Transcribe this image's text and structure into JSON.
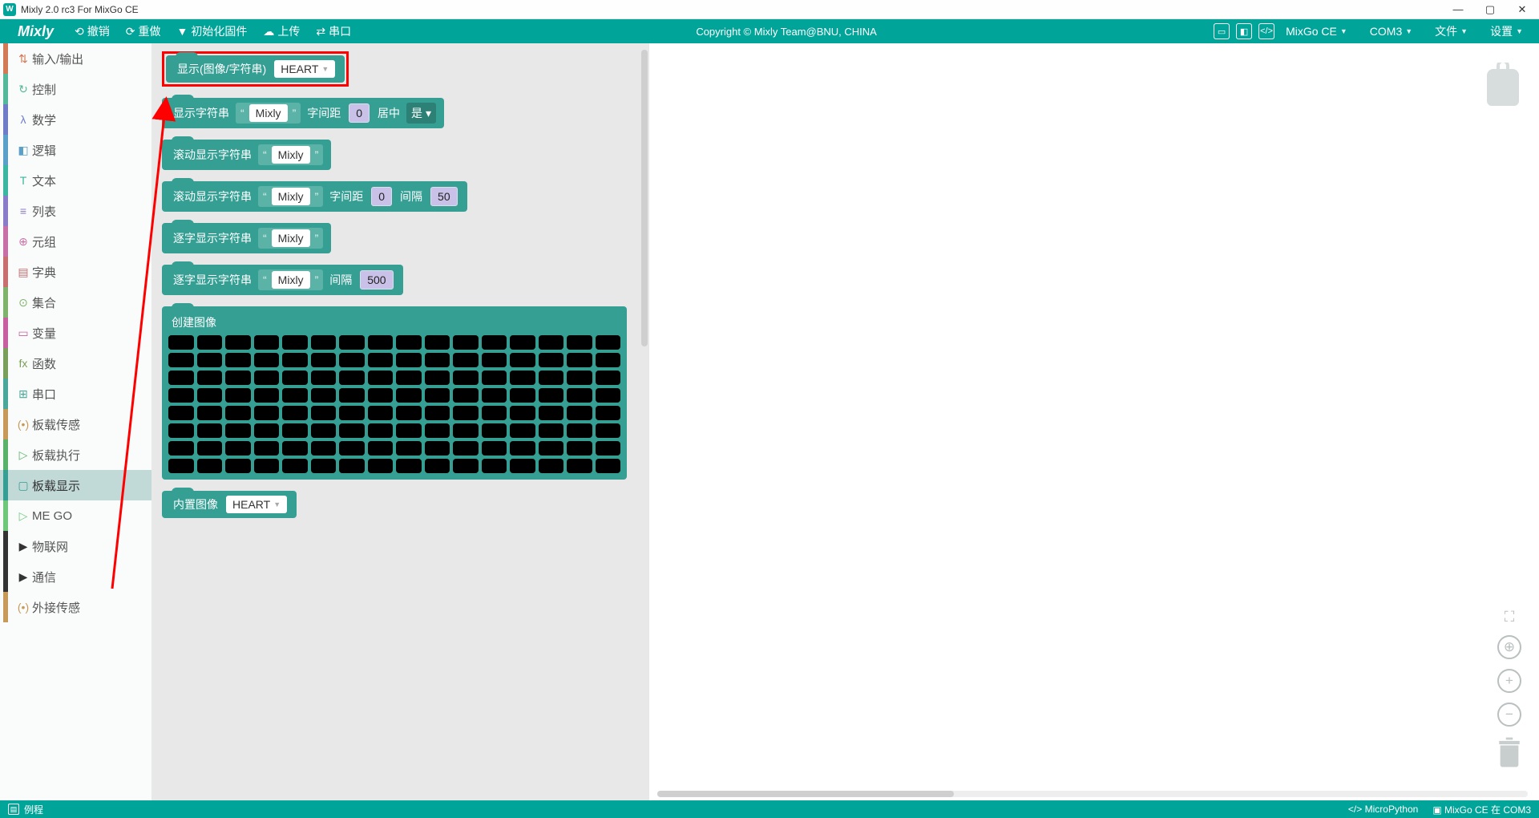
{
  "window": {
    "title": "Mixly 2.0 rc3 For MixGo CE"
  },
  "menubar": {
    "brand": "Mixly",
    "btns": [
      {
        "icon": "↺",
        "label": "撤销"
      },
      {
        "icon": "↻",
        "label": "重做"
      },
      {
        "icon": "⟲",
        "label": "初始化固件"
      },
      {
        "icon": "⬆",
        "label": "上传"
      },
      {
        "icon": "⇄",
        "label": "串口"
      }
    ],
    "copyright": "Copyright © Mixly Team@BNU, CHINA",
    "board_sel": "MixGo CE",
    "port_sel": "COM3",
    "file_menu": "文件",
    "settings_menu": "设置"
  },
  "sidebar": {
    "items": [
      {
        "label": "输入/输出",
        "color": "#d17a55",
        "icon": "⇅"
      },
      {
        "label": "控制",
        "color": "#54b89a",
        "icon": "↻"
      },
      {
        "label": "数学",
        "color": "#6f7dc8",
        "icon": "λ"
      },
      {
        "label": "逻辑",
        "color": "#5aa0c8",
        "icon": "◧"
      },
      {
        "label": "文本",
        "color": "#3bb6a0",
        "icon": "T"
      },
      {
        "label": "列表",
        "color": "#8a7cc8",
        "icon": "≡"
      },
      {
        "label": "元组",
        "color": "#c86fa8",
        "icon": "⊕"
      },
      {
        "label": "字典",
        "color": "#c86f6f",
        "icon": "▤"
      },
      {
        "label": "集合",
        "color": "#7fb26a",
        "icon": "⊙"
      },
      {
        "label": "变量",
        "color": "#c85fa0",
        "icon": "▭"
      },
      {
        "label": "函数",
        "color": "#7a9f5a",
        "icon": "fx"
      },
      {
        "label": "串口",
        "color": "#4aa89a",
        "icon": "⊞"
      },
      {
        "label": "板载传感",
        "color": "#c89a5a",
        "icon": "(•)"
      },
      {
        "label": "板载执行",
        "color": "#5ab26a",
        "icon": "▷"
      },
      {
        "label": "板载显示",
        "color": "#359f94",
        "icon": "▢",
        "active": true
      },
      {
        "label": "ME GO",
        "color": "#6fc87a",
        "icon": "▷"
      },
      {
        "label": "物联网",
        "color": "#333",
        "icon": "▶"
      },
      {
        "label": "通信",
        "color": "#333",
        "icon": "▶"
      },
      {
        "label": "外接传感",
        "color": "#c89a5a",
        "icon": "(•)"
      }
    ]
  },
  "blocks": {
    "b1": {
      "label": "显示(图像/字符串)",
      "val": "HEART"
    },
    "b2": {
      "label": "显示字符串",
      "str": "Mixly",
      "gap_lbl": "字间距",
      "gap": "0",
      "center_lbl": "居中",
      "center": "是"
    },
    "b3": {
      "label": "滚动显示字符串",
      "str": "Mixly"
    },
    "b4": {
      "label": "滚动显示字符串",
      "str": "Mixly",
      "gap_lbl": "字间距",
      "gap": "0",
      "int_lbl": "间隔",
      "int": "50"
    },
    "b5": {
      "label": "逐字显示字符串",
      "str": "Mixly"
    },
    "b6": {
      "label": "逐字显示字符串",
      "str": "Mixly",
      "int_lbl": "间隔",
      "int": "500"
    },
    "matrix": {
      "label": "创建图像",
      "rows": 8,
      "cols": 16
    },
    "b7": {
      "label": "内置图像",
      "val": "HEART"
    }
  },
  "status": {
    "left_icon": "▤",
    "left": "例程",
    "lang": "MicroPython",
    "conn": "MixGo CE 在 COM3"
  }
}
